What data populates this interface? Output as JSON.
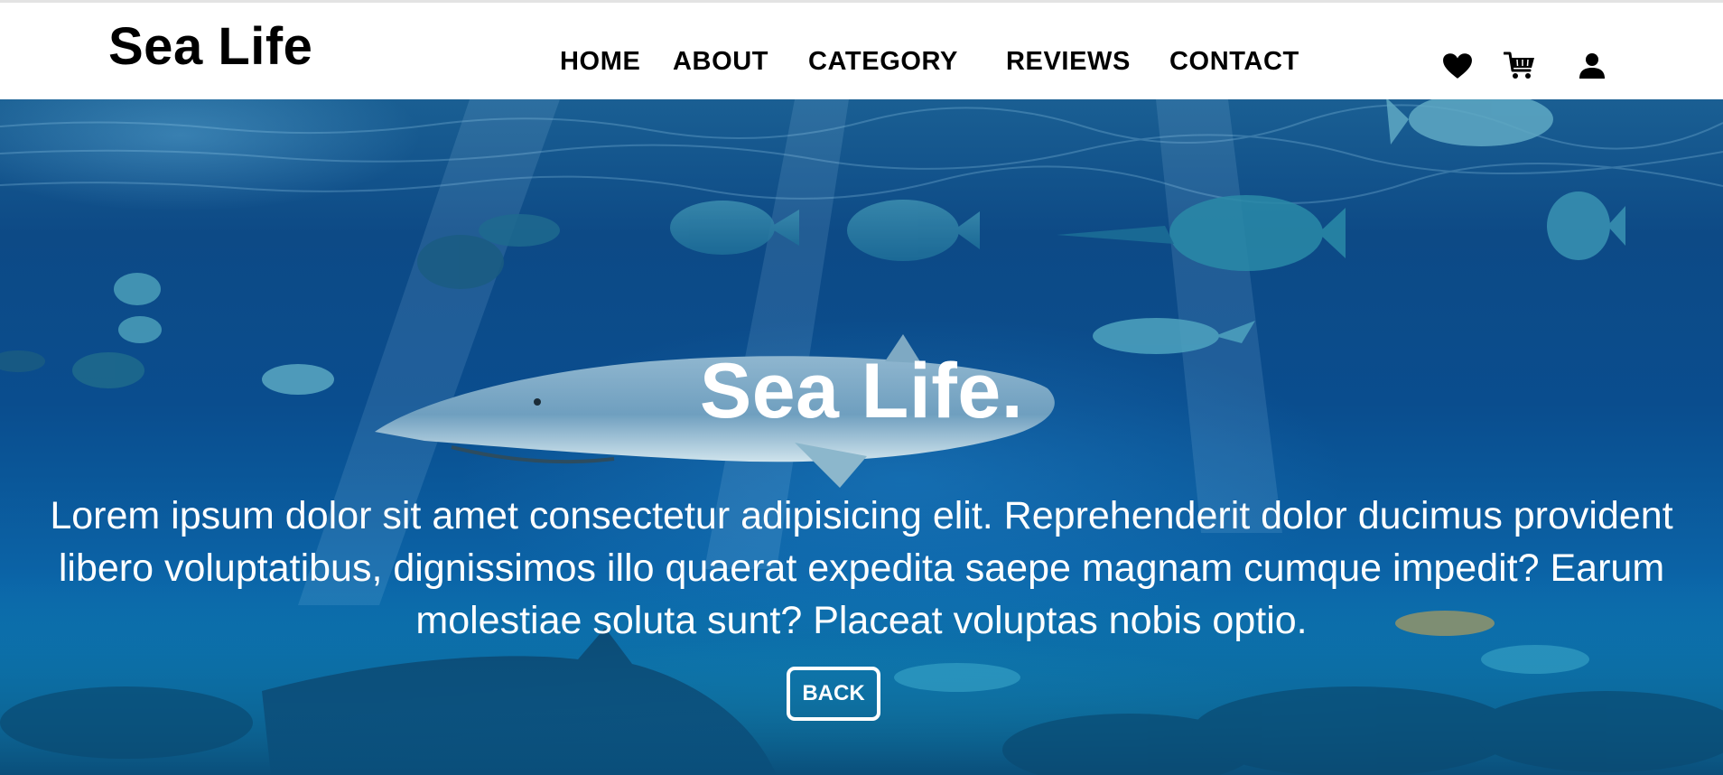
{
  "header": {
    "logo": "Sea Life",
    "nav": [
      "HOME",
      "ABOUT",
      "CATEGORY",
      "REVIEWS",
      "CONTACT"
    ],
    "icons": [
      "heart-icon",
      "cart-icon",
      "user-icon"
    ]
  },
  "hero": {
    "title": "Sea Life.",
    "text": "Lorem ipsum dolor sit amet consectetur adipisicing elit. Reprehenderit dolor ducimus provident libero voluptatibus, dignissimos illo quaerat expedita saepe magnam cumque impedit? Earum molestiae soluta sunt? Placeat voluptas nobis optio.",
    "button_label": "BACK",
    "background_image": "underwater-shark-and-fish"
  },
  "colors": {
    "header_bg": "#ffffff",
    "text_dark": "#000000",
    "hero_text": "#ffffff",
    "water_deep": "#0a4d8e",
    "water_light": "#14a7d0"
  }
}
